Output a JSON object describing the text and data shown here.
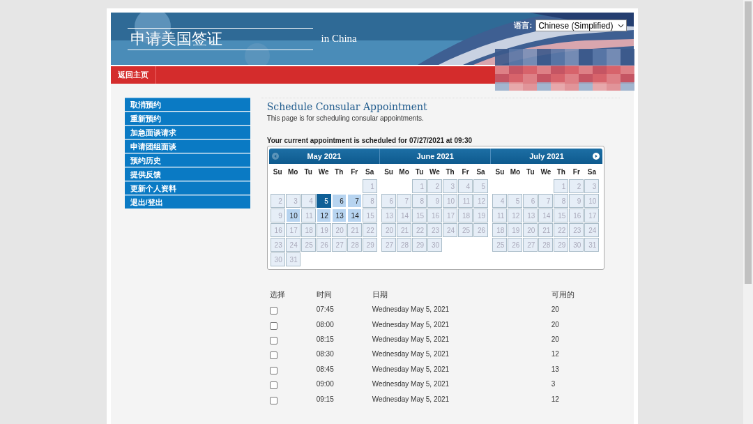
{
  "header": {
    "title": "申请美国签证",
    "subtitle": "in China",
    "language_label": "语言:",
    "language_value": "Chinese (Simplified)"
  },
  "nav": {
    "home": "返回主页"
  },
  "sidebar": {
    "items": [
      {
        "label": "取消预约"
      },
      {
        "label": "重新预约"
      },
      {
        "label": "加急面谈请求"
      },
      {
        "label": "申请团组面谈"
      },
      {
        "label": "预约历史"
      },
      {
        "label": "提供反馈"
      },
      {
        "label": "更新个人资料"
      },
      {
        "label": "退出/登出"
      }
    ]
  },
  "page": {
    "title": "Schedule Consular Appointment",
    "intro": "This page is for scheduling consular appointments.",
    "current": "Your current appointment is scheduled for 07/27/2021 at 09:30"
  },
  "calendar": {
    "prev_disabled": true,
    "next_disabled": false,
    "months": [
      {
        "title": "May 2021",
        "weekdays": [
          "Su",
          "Mo",
          "Tu",
          "We",
          "Th",
          "Fr",
          "Sa"
        ],
        "days": [
          {
            "kind": "blank"
          },
          {
            "kind": "blank"
          },
          {
            "kind": "blank"
          },
          {
            "kind": "blank"
          },
          {
            "kind": "blank"
          },
          {
            "kind": "blank"
          },
          {
            "label": "1",
            "kind": "off"
          },
          {
            "label": "2",
            "kind": "off"
          },
          {
            "label": "3",
            "kind": "off"
          },
          {
            "label": "4",
            "kind": "off"
          },
          {
            "label": "5",
            "kind": "selected"
          },
          {
            "label": "6",
            "kind": "open"
          },
          {
            "label": "7",
            "kind": "open"
          },
          {
            "label": "8",
            "kind": "off"
          },
          {
            "label": "9",
            "kind": "off"
          },
          {
            "label": "10",
            "kind": "open"
          },
          {
            "label": "11",
            "kind": "off"
          },
          {
            "label": "12",
            "kind": "open"
          },
          {
            "label": "13",
            "kind": "open"
          },
          {
            "label": "14",
            "kind": "open"
          },
          {
            "label": "15",
            "kind": "off"
          },
          {
            "label": "16",
            "kind": "off"
          },
          {
            "label": "17",
            "kind": "off"
          },
          {
            "label": "18",
            "kind": "off"
          },
          {
            "label": "19",
            "kind": "off"
          },
          {
            "label": "20",
            "kind": "off"
          },
          {
            "label": "21",
            "kind": "off"
          },
          {
            "label": "22",
            "kind": "off"
          },
          {
            "label": "23",
            "kind": "off"
          },
          {
            "label": "24",
            "kind": "off"
          },
          {
            "label": "25",
            "kind": "off"
          },
          {
            "label": "26",
            "kind": "off"
          },
          {
            "label": "27",
            "kind": "off"
          },
          {
            "label": "28",
            "kind": "off"
          },
          {
            "label": "29",
            "kind": "off"
          },
          {
            "label": "30",
            "kind": "off"
          },
          {
            "label": "31",
            "kind": "off"
          }
        ]
      },
      {
        "title": "June 2021",
        "weekdays": [
          "Su",
          "Mo",
          "Tu",
          "We",
          "Th",
          "Fr",
          "Sa"
        ],
        "days": [
          {
            "kind": "blank"
          },
          {
            "kind": "blank"
          },
          {
            "label": "1",
            "kind": "off"
          },
          {
            "label": "2",
            "kind": "off"
          },
          {
            "label": "3",
            "kind": "off"
          },
          {
            "label": "4",
            "kind": "off"
          },
          {
            "label": "5",
            "kind": "off"
          },
          {
            "label": "6",
            "kind": "off"
          },
          {
            "label": "7",
            "kind": "off"
          },
          {
            "label": "8",
            "kind": "off"
          },
          {
            "label": "9",
            "kind": "off"
          },
          {
            "label": "10",
            "kind": "off"
          },
          {
            "label": "11",
            "kind": "off"
          },
          {
            "label": "12",
            "kind": "off"
          },
          {
            "label": "13",
            "kind": "off"
          },
          {
            "label": "14",
            "kind": "off"
          },
          {
            "label": "15",
            "kind": "off"
          },
          {
            "label": "16",
            "kind": "off"
          },
          {
            "label": "17",
            "kind": "off"
          },
          {
            "label": "18",
            "kind": "off"
          },
          {
            "label": "19",
            "kind": "off"
          },
          {
            "label": "20",
            "kind": "off"
          },
          {
            "label": "21",
            "kind": "off"
          },
          {
            "label": "22",
            "kind": "off"
          },
          {
            "label": "23",
            "kind": "off"
          },
          {
            "label": "24",
            "kind": "off"
          },
          {
            "label": "25",
            "kind": "off"
          },
          {
            "label": "26",
            "kind": "off"
          },
          {
            "label": "27",
            "kind": "off"
          },
          {
            "label": "28",
            "kind": "off"
          },
          {
            "label": "29",
            "kind": "off"
          },
          {
            "label": "30",
            "kind": "off"
          }
        ]
      },
      {
        "title": "July 2021",
        "weekdays": [
          "Su",
          "Mo",
          "Tu",
          "We",
          "Th",
          "Fr",
          "Sa"
        ],
        "days": [
          {
            "kind": "blank"
          },
          {
            "kind": "blank"
          },
          {
            "kind": "blank"
          },
          {
            "kind": "blank"
          },
          {
            "label": "1",
            "kind": "off"
          },
          {
            "label": "2",
            "kind": "off"
          },
          {
            "label": "3",
            "kind": "off"
          },
          {
            "label": "4",
            "kind": "off"
          },
          {
            "label": "5",
            "kind": "off"
          },
          {
            "label": "6",
            "kind": "off"
          },
          {
            "label": "7",
            "kind": "off"
          },
          {
            "label": "8",
            "kind": "off"
          },
          {
            "label": "9",
            "kind": "off"
          },
          {
            "label": "10",
            "kind": "off"
          },
          {
            "label": "11",
            "kind": "off"
          },
          {
            "label": "12",
            "kind": "off"
          },
          {
            "label": "13",
            "kind": "off"
          },
          {
            "label": "14",
            "kind": "off"
          },
          {
            "label": "15",
            "kind": "off"
          },
          {
            "label": "16",
            "kind": "off"
          },
          {
            "label": "17",
            "kind": "off"
          },
          {
            "label": "18",
            "kind": "off"
          },
          {
            "label": "19",
            "kind": "off"
          },
          {
            "label": "20",
            "kind": "off"
          },
          {
            "label": "21",
            "kind": "off"
          },
          {
            "label": "22",
            "kind": "off"
          },
          {
            "label": "23",
            "kind": "off"
          },
          {
            "label": "24",
            "kind": "off"
          },
          {
            "label": "25",
            "kind": "off"
          },
          {
            "label": "26",
            "kind": "off"
          },
          {
            "label": "27",
            "kind": "off"
          },
          {
            "label": "28",
            "kind": "off"
          },
          {
            "label": "29",
            "kind": "off"
          },
          {
            "label": "30",
            "kind": "off"
          },
          {
            "label": "31",
            "kind": "off"
          }
        ]
      }
    ]
  },
  "slots": {
    "columns": [
      "选择",
      "时间",
      "日期",
      "可用的"
    ],
    "rows": [
      {
        "checked": false,
        "time": "07:45",
        "date": "Wednesday May 5, 2021",
        "available": "20"
      },
      {
        "checked": false,
        "time": "08:00",
        "date": "Wednesday May 5, 2021",
        "available": "20"
      },
      {
        "checked": false,
        "time": "08:15",
        "date": "Wednesday May 5, 2021",
        "available": "20"
      },
      {
        "checked": false,
        "time": "08:30",
        "date": "Wednesday May 5, 2021",
        "available": "12"
      },
      {
        "checked": false,
        "time": "08:45",
        "date": "Wednesday May 5, 2021",
        "available": "13"
      },
      {
        "checked": false,
        "time": "09:00",
        "date": "Wednesday May 5, 2021",
        "available": "3"
      },
      {
        "checked": false,
        "time": "09:15",
        "date": "Wednesday May 5, 2021",
        "available": "12"
      }
    ]
  }
}
